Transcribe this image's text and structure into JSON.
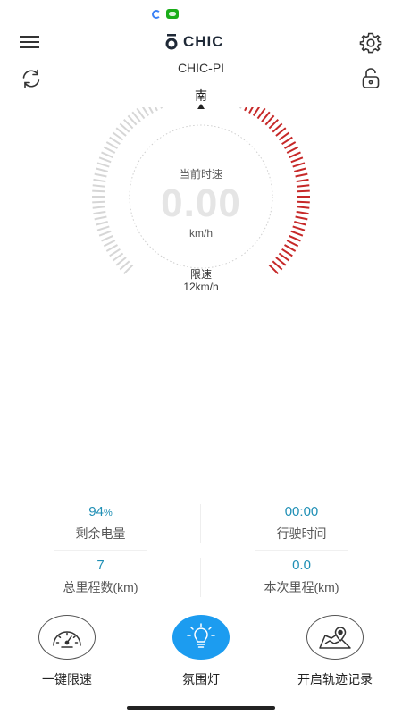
{
  "status_bar": {
    "icons": [
      "loading-icon",
      "wechat-icon"
    ]
  },
  "header": {
    "logo_text": "CHIC",
    "device_name": "CHIC-PI",
    "icons": {
      "menu": "menu-icon",
      "settings": "gear-icon",
      "refresh": "refresh-icon",
      "lock": "unlock-icon"
    }
  },
  "gauge": {
    "direction": "南",
    "speed_label": "当前时速",
    "speed_value": "0.00",
    "speed_unit": "km/h",
    "limit_label": "限速",
    "limit_value": "12km/h",
    "colors": {
      "normal": "#d6d6d6",
      "danger": "#c62828",
      "speed_text": "#e5e5e5"
    }
  },
  "stats": {
    "battery": {
      "value": "94",
      "unit": "%",
      "label": "剩余电量"
    },
    "ride_time": {
      "value": "00:00",
      "label": "行驶时间"
    },
    "total_distance": {
      "value": "7",
      "label": "总里程数",
      "unit": "(km)"
    },
    "trip_distance": {
      "value": "0.0",
      "label": "本次里程",
      "unit": "(km)"
    },
    "value_color": "#1f8fb5"
  },
  "actions": [
    {
      "label": "一键限速",
      "icon": "speedometer-icon",
      "active": false
    },
    {
      "label": "氛围灯",
      "icon": "lightbulb-icon",
      "active": true
    },
    {
      "label": "开启轨迹记录",
      "icon": "map-pin-icon",
      "active": false
    }
  ],
  "accent_color": "#1c9cf0"
}
